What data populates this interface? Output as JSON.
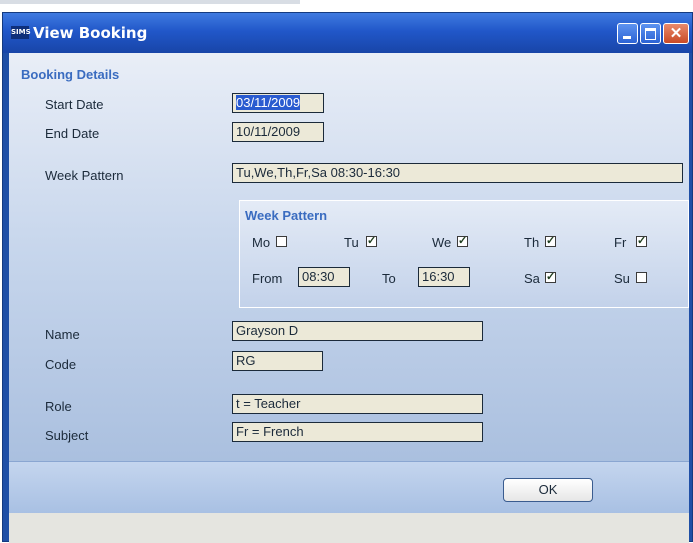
{
  "window": {
    "title": "View Booking",
    "app_icon": "SIMS"
  },
  "booking": {
    "group_title": "Booking Details",
    "start_date_label": "Start Date",
    "start_date": "03/11/2009",
    "end_date_label": "End Date",
    "end_date": "10/11/2009",
    "week_pattern_label": "Week Pattern",
    "week_pattern": "Tu,We,Th,Fr,Sa 08:30-16:30"
  },
  "week_pattern": {
    "title": "Week Pattern",
    "days": [
      {
        "label": "Mo",
        "checked": false
      },
      {
        "label": "Tu",
        "checked": true
      },
      {
        "label": "We",
        "checked": true
      },
      {
        "label": "Th",
        "checked": true
      },
      {
        "label": "Fr",
        "checked": true
      },
      {
        "label": "Sa",
        "checked": true
      },
      {
        "label": "Su",
        "checked": false
      }
    ],
    "from_label": "From",
    "from": "08:30",
    "to_label": "To",
    "to": "16:30"
  },
  "person": {
    "name_label": "Name",
    "name": "Grayson D",
    "code_label": "Code",
    "code": "RG",
    "role_label": "Role",
    "role": "t = Teacher",
    "subject_label": "Subject",
    "subject": "Fr = French"
  },
  "buttons": {
    "ok": "OK"
  }
}
